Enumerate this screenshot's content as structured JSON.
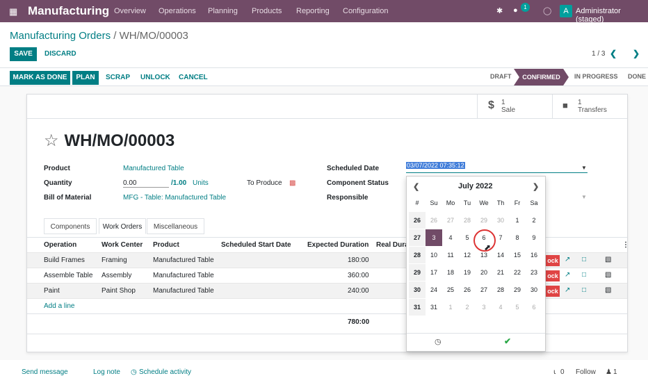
{
  "topbar": {
    "app": "Manufacturing",
    "menu": [
      "Overview",
      "Operations",
      "Planning",
      "Products",
      "Reporting",
      "Configuration"
    ],
    "chat_count": "1",
    "avatar": "A",
    "user": "Administrator (staged)"
  },
  "breadcrumb": {
    "parent": "Manufacturing Orders",
    "sep": " / ",
    "current": "WH/MO/00003"
  },
  "buttons": {
    "save": "SAVE",
    "discard": "DISCARD",
    "mark_done": "MARK AS DONE",
    "plan": "PLAN",
    "scrap": "SCRAP",
    "unlock": "UNLOCK",
    "cancel": "CANCEL"
  },
  "pager": "1 / 3",
  "stages": [
    "DRAFT",
    "CONFIRMED",
    "IN PROGRESS",
    "DONE"
  ],
  "stat": {
    "sale_count": "1",
    "sale_label": "Sale",
    "transfer_count": "1",
    "transfer_label": "Transfers"
  },
  "record_title": "WH/MO/00003",
  "fields": {
    "product_label": "Product",
    "product": "Manufactured Table",
    "quantity_label": "Quantity",
    "quantity": "0.00",
    "quantity_total": "/1.00",
    "uom": "Units",
    "to_produce": "To Produce",
    "bom_label": "Bill of Material",
    "bom": "MFG - Table: Manufactured Table",
    "sched_label": "Scheduled Date",
    "sched_value": "03/07/2022 07:35:12",
    "component_label": "Component Status",
    "responsible_label": "Responsible"
  },
  "tabs": [
    "Components",
    "Work Orders",
    "Miscellaneous"
  ],
  "table": {
    "headers": [
      "Operation",
      "Work Center",
      "Product",
      "Scheduled Start Date",
      "Expected Duration",
      "Real Dura"
    ],
    "rows": [
      [
        "Build Frames",
        "Framing",
        "Manufactured Table",
        "",
        "180:00"
      ],
      [
        "Assemble Table",
        "Assembly",
        "Manufactured Table",
        "",
        "360:00"
      ],
      [
        "Paint",
        "Paint Shop",
        "Manufactured Table",
        "",
        "240:00"
      ]
    ],
    "add_line": "Add a line",
    "total": "780:00",
    "block": "ock"
  },
  "calendar": {
    "month": "July 2022",
    "weekdays": [
      "#",
      "Su",
      "Mo",
      "Tu",
      "We",
      "Th",
      "Fr",
      "Sa"
    ],
    "weeks": [
      [
        "26",
        "26",
        "27",
        "28",
        "29",
        "30",
        "1",
        "2"
      ],
      [
        "27",
        "3",
        "4",
        "5",
        "6",
        "7",
        "8",
        "9"
      ],
      [
        "28",
        "10",
        "11",
        "12",
        "13",
        "14",
        "15",
        "16"
      ],
      [
        "29",
        "17",
        "18",
        "19",
        "20",
        "21",
        "22",
        "23"
      ],
      [
        "30",
        "24",
        "25",
        "26",
        "27",
        "28",
        "29",
        "30"
      ],
      [
        "31",
        "31",
        "1",
        "2",
        "3",
        "4",
        "5",
        "6"
      ]
    ],
    "selected": "3"
  },
  "chatter": {
    "send": "Send message",
    "log": "Log note",
    "schedule": "Schedule activity",
    "attach": "0",
    "follow": "Follow",
    "followers": "1"
  }
}
